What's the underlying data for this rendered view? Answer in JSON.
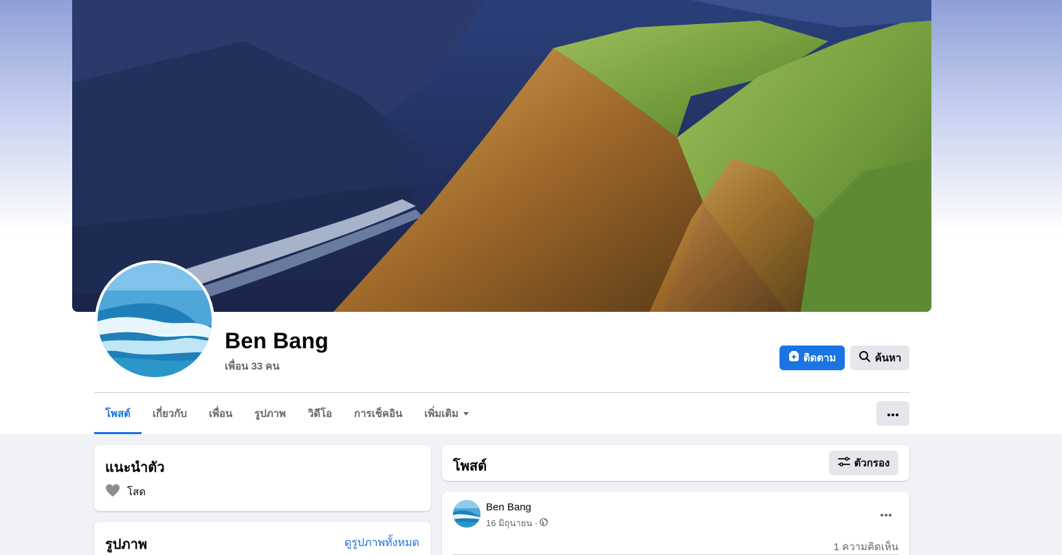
{
  "profile": {
    "name": "Ben Bang",
    "friends": "เพื่อน 33 คน"
  },
  "actions": {
    "follow_label": "ติดตาม",
    "search_label": "ค้นหา"
  },
  "tabs": [
    {
      "label": "โพสต์",
      "active": true
    },
    {
      "label": "เกี่ยวกับ"
    },
    {
      "label": "เพื่อน"
    },
    {
      "label": "รูปภาพ"
    },
    {
      "label": "วิดีโอ"
    },
    {
      "label": "การเช็คอิน"
    },
    {
      "label": "เพิ่มเติม"
    }
  ],
  "intro": {
    "title": "แนะนำตัว",
    "relationship": "โสด"
  },
  "photos": {
    "title": "รูปภาพ",
    "see_all": "ดูรูปภาพทั้งหมด"
  },
  "posts": {
    "title": "โพสต์",
    "filter_label": "ตัวกรอง"
  },
  "post": {
    "author": "Ben Bang",
    "date": "16 มิถุนายน ·",
    "comments": "1 ความคิดเห็น"
  },
  "colors": {
    "accent": "#1b74e4",
    "secondary_text": "#65676b",
    "button_gray": "#e4e6eb"
  },
  "icons": {
    "follow": "follow-plus-icon",
    "search": "search-icon",
    "dropdown": "caret-down-icon",
    "more": "more-horizontal-icon",
    "relationship": "heart-icon",
    "filter": "filter-sliders-icon",
    "privacy": "globe-icon"
  }
}
